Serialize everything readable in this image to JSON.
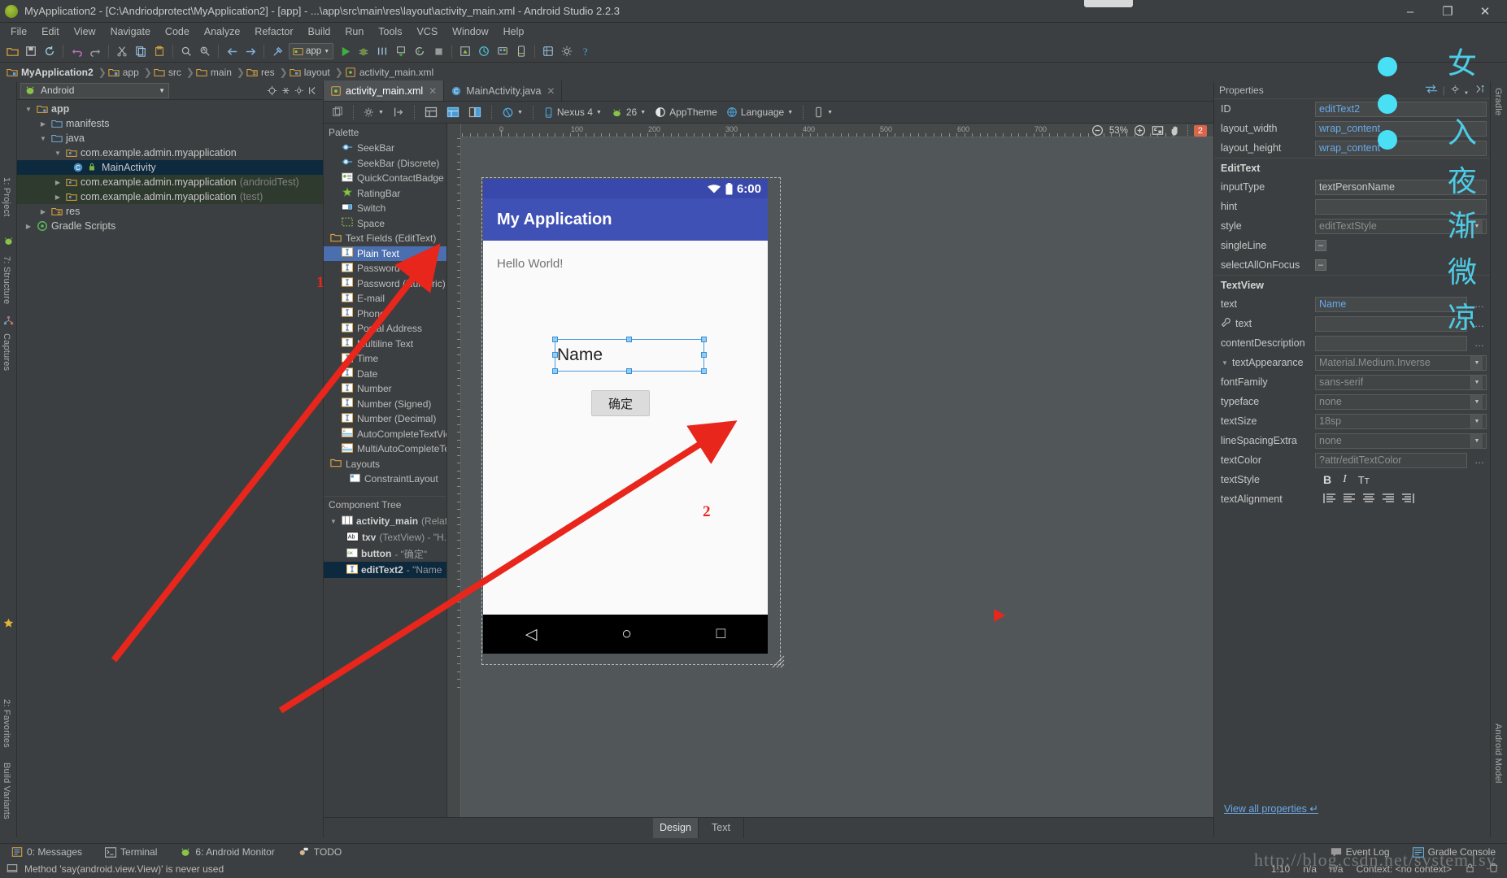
{
  "window": {
    "title": "MyApplication2 - [C:\\Andriodprotect\\MyApplication2] - [app] - ...\\app\\src\\main\\res\\layout\\activity_main.xml - Android Studio 2.2.3",
    "minimize": "–",
    "maximize": "❐",
    "close": "✕"
  },
  "menu": [
    "File",
    "Edit",
    "View",
    "Navigate",
    "Code",
    "Analyze",
    "Refactor",
    "Build",
    "Run",
    "Tools",
    "VCS",
    "Window",
    "Help"
  ],
  "toolbar": {
    "run_config": "app"
  },
  "breadcrumb": [
    "MyApplication2",
    "app",
    "src",
    "main",
    "res",
    "layout",
    "activity_main.xml"
  ],
  "left_rail": [
    "1: Project",
    "7: Structure",
    "Captures",
    "2: Favorites",
    "Build Variants"
  ],
  "right_rail": [
    "Gradle",
    "Android Model"
  ],
  "project": {
    "selector": "Android",
    "tree": [
      {
        "label": "app",
        "indent": 0,
        "expand": "down",
        "icon": "module",
        "bold": true
      },
      {
        "label": "manifests",
        "indent": 1,
        "expand": "right",
        "icon": "folder"
      },
      {
        "label": "java",
        "indent": 1,
        "expand": "down",
        "icon": "folder"
      },
      {
        "label": "com.example.admin.myapplication",
        "indent": 2,
        "expand": "down",
        "icon": "package"
      },
      {
        "label": "MainActivity",
        "indent": 3,
        "expand": "none",
        "icon": "class",
        "selected": true
      },
      {
        "label": "com.example.admin.myapplication",
        "dim": "(androidTest)",
        "indent": 2,
        "expand": "right",
        "icon": "package",
        "testbg": true
      },
      {
        "label": "com.example.admin.myapplication",
        "dim": "(test)",
        "indent": 2,
        "expand": "right",
        "icon": "package",
        "testbg": true
      },
      {
        "label": "res",
        "indent": 1,
        "expand": "right",
        "icon": "resfolder"
      },
      {
        "label": "Gradle Scripts",
        "indent": 0,
        "expand": "right",
        "icon": "gradle"
      }
    ]
  },
  "editor": {
    "tabs": [
      {
        "label": "activity_main.xml",
        "icon": "layout-file",
        "active": true
      },
      {
        "label": "MainActivity.java",
        "icon": "java-class",
        "active": false
      }
    ],
    "design_toolbar": {
      "device": "Nexus 4",
      "api": "26",
      "theme": "AppTheme",
      "language": "Language"
    },
    "zoom": {
      "level": "53%",
      "warnings": "2"
    },
    "bottom_tabs": [
      {
        "label": "Design",
        "active": true
      },
      {
        "label": "Text",
        "active": false
      }
    ]
  },
  "palette": {
    "title": "Palette",
    "items": [
      {
        "label": "SeekBar",
        "icon": "seekbar-icon"
      },
      {
        "label": "SeekBar (Discrete)",
        "icon": "seekbar-icon"
      },
      {
        "label": "QuickContactBadge",
        "icon": "contact-icon"
      },
      {
        "label": "RatingBar",
        "icon": "star-icon"
      },
      {
        "label": "Switch",
        "icon": "switch-icon"
      },
      {
        "label": "Space",
        "icon": "space-icon"
      },
      {
        "label": "Text Fields (EditText)",
        "icon": "folder-icon",
        "group": true
      },
      {
        "label": "Plain Text",
        "icon": "edittext-icon",
        "selected": true
      },
      {
        "label": "Password",
        "icon": "edittext-icon"
      },
      {
        "label": "Password (Numeric)",
        "icon": "edittext-icon"
      },
      {
        "label": "E-mail",
        "icon": "edittext-icon"
      },
      {
        "label": "Phone",
        "icon": "edittext-icon"
      },
      {
        "label": "Postal Address",
        "icon": "edittext-icon"
      },
      {
        "label": "Multiline Text",
        "icon": "edittext-icon"
      },
      {
        "label": "Time",
        "icon": "edittext-icon"
      },
      {
        "label": "Date",
        "icon": "edittext-icon"
      },
      {
        "label": "Number",
        "icon": "edittext-icon"
      },
      {
        "label": "Number (Signed)",
        "icon": "edittext-icon"
      },
      {
        "label": "Number (Decimal)",
        "icon": "edittext-icon"
      },
      {
        "label": "AutoCompleteTextView",
        "icon": "autocomplete-icon"
      },
      {
        "label": "MultiAutoCompleteTextView",
        "icon": "autocomplete-icon"
      },
      {
        "label": "Layouts",
        "icon": "folder-icon",
        "group": true
      },
      {
        "label": "ConstraintLayout",
        "icon": "layout-icon",
        "sub": true
      }
    ]
  },
  "component_tree": {
    "title": "Component Tree",
    "items": [
      {
        "label": "activity_main",
        "dim": "(RelativeLayout)",
        "indent": 0,
        "expand": "down",
        "icon": "relativelayout-icon"
      },
      {
        "label": "txv",
        "dim": "(TextView) - \"H...",
        "indent": 1,
        "icon": "textview-icon"
      },
      {
        "label": "button",
        "dim": "- \"确定\"",
        "indent": 1,
        "icon": "button-icon"
      },
      {
        "label": "editText2",
        "dim": "- \"Name",
        "indent": 1,
        "icon": "edittext-icon",
        "selected": true
      }
    ]
  },
  "preview": {
    "status_time": "6:00",
    "app_title": "My Application",
    "hello_text": "Hello World!",
    "edittext_value": "Name",
    "button_label": "确定",
    "ruler_top": [
      "0",
      "100",
      "200",
      "300",
      "400",
      "500",
      "600",
      "700"
    ],
    "nav_back": "◁",
    "nav_home": "○",
    "nav_recent": "□"
  },
  "properties": {
    "title": "Properties",
    "rows": [
      {
        "label": "ID",
        "value": "editText2",
        "type": "text",
        "link": true
      },
      {
        "label": "layout_width",
        "value": "wrap_content",
        "type": "text",
        "link": true
      },
      {
        "label": "layout_height",
        "value": "wrap_content",
        "type": "text",
        "link": true
      }
    ],
    "section_edittext": "EditText",
    "edittext_rows": [
      {
        "label": "inputType",
        "value": "textPersonName",
        "type": "text"
      },
      {
        "label": "hint",
        "value": "",
        "type": "text"
      },
      {
        "label": "style",
        "value": "editTextStyle",
        "type": "dropdown",
        "dim": true
      },
      {
        "label": "singleLine",
        "value": "–",
        "type": "tristate"
      },
      {
        "label": "selectAllOnFocus",
        "value": "–",
        "type": "tristate"
      }
    ],
    "section_textview": "TextView",
    "textview_rows": [
      {
        "label": "text",
        "value": "Name",
        "type": "ellipsis",
        "link": true
      },
      {
        "label": "text",
        "value": "",
        "type": "ellipsis",
        "wrench": true
      },
      {
        "label": "contentDescription",
        "value": "",
        "type": "ellipsis"
      },
      {
        "label": "textAppearance",
        "value": "Material.Medium.Inverse",
        "type": "dropdown",
        "dim": true,
        "expander": true
      },
      {
        "label": "fontFamily",
        "value": "sans-serif",
        "type": "dropdown",
        "dim": true
      },
      {
        "label": "typeface",
        "value": "none",
        "type": "dropdown",
        "dim": true
      },
      {
        "label": "textSize",
        "value": "18sp",
        "type": "dropdown",
        "dim": true
      },
      {
        "label": "lineSpacingExtra",
        "value": "none",
        "type": "dropdown",
        "dim": true
      },
      {
        "label": "textColor",
        "value": "?attr/editTextColor",
        "type": "ellipsis",
        "dim": true
      },
      {
        "label": "textStyle",
        "value": "",
        "type": "textstyle"
      },
      {
        "label": "textAlignment",
        "value": "",
        "type": "alignment"
      }
    ],
    "view_all": "View all properties"
  },
  "bottom": {
    "tool_windows": [
      {
        "label": "0: Messages",
        "icon": "messages-icon"
      },
      {
        "label": "Terminal",
        "icon": "terminal-icon"
      },
      {
        "label": "6: Android Monitor",
        "icon": "android-icon"
      },
      {
        "label": "TODO",
        "icon": "todo-icon"
      }
    ],
    "status_message": "Method 'say(android.view.View)' is never used",
    "caret": "1:10",
    "encoding": "n/a",
    "line_sep": "n/a",
    "context": "Context: <no context>",
    "right_items": [
      {
        "label": "Event Log",
        "icon": "event-log-icon"
      },
      {
        "label": "Gradle Console",
        "icon": "gradle-console-icon"
      }
    ]
  },
  "annotations": {
    "number_one": "1",
    "number_two": "2",
    "watermark_cn": [
      "女",
      "入",
      "夜",
      "渐",
      "微",
      "凉"
    ],
    "watermark_url": "http://blog.csdn.net/system1sy"
  },
  "colors": {
    "accent_blue": "#4b6eaf",
    "appbar": "#3f51b5",
    "statusbar": "#3949ab",
    "selection_tree": "#0d293e",
    "annotation_red": "#e8261c",
    "watermark_cyan": "#49e0f5",
    "warning_badge": "#d9654a",
    "link_blue": "#6aa9e8"
  }
}
